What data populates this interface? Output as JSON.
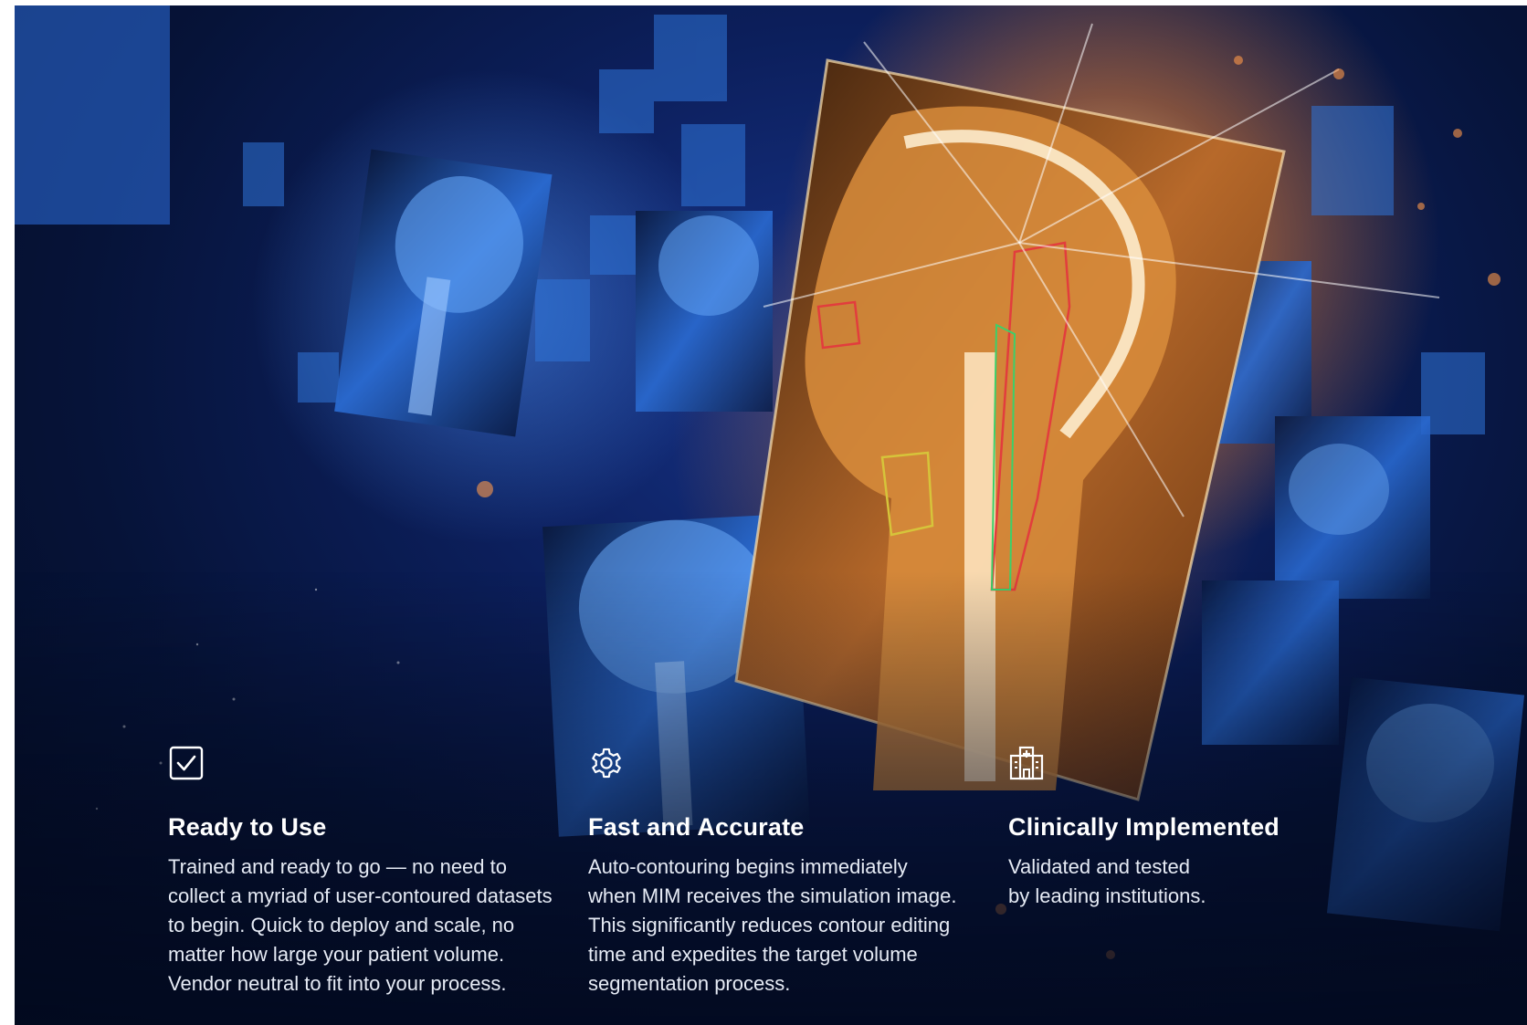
{
  "features": [
    {
      "icon": "checkbox-check-icon",
      "title": "Ready to Use",
      "description": "Trained and ready to go — no need to\ncollect a myriad of user-contoured datasets\nto begin. Quick to deploy and scale, no\nmatter how large your patient volume.\nVendor neutral to fit into your process."
    },
    {
      "icon": "gear-icon",
      "title": "Fast and Accurate",
      "description": "Auto-contouring begins immediately\nwhen MIM receives the simulation image.\nThis significantly reduces contour editing\ntime and expedites the target volume\nsegmentation process."
    },
    {
      "icon": "hospital-icon",
      "title": "Clinically Implemented",
      "description": "Validated and tested\nby leading institutions."
    }
  ],
  "colors": {
    "background_dark": "#061338",
    "scan_blue": "#3f8ef0",
    "scan_orange": "#e89a3c",
    "text": "#ffffff"
  }
}
